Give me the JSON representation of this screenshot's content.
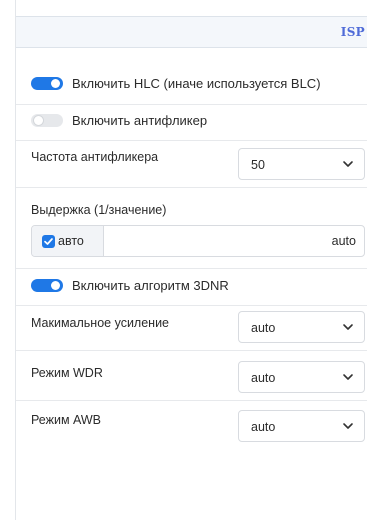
{
  "header": {
    "title": "ISP"
  },
  "hlc_toggle": {
    "label": "Включить HLC (иначе используется BLC)",
    "checked": true
  },
  "antiflicker_toggle": {
    "label": "Включить антифликер",
    "checked": false
  },
  "antiflicker_freq": {
    "label": "Частота антифликера",
    "value": "50"
  },
  "exposure": {
    "label": "Выдержка (1/значение)",
    "auto_checkbox_label": "авто",
    "auto_checked": true,
    "value": "auto"
  },
  "dnr_toggle": {
    "label": "Включить алгоритм 3DNR",
    "checked": true
  },
  "max_gain": {
    "label": "Макимальное усиление",
    "value": "auto"
  },
  "wdr_mode": {
    "label": "Режим WDR",
    "value": "auto"
  },
  "awb_mode": {
    "label": "Режим AWB",
    "value": "auto"
  },
  "colors": {
    "accent": "#1f78e6",
    "header_text": "#4f6bd8",
    "header_bg": "#f4f7fb"
  }
}
